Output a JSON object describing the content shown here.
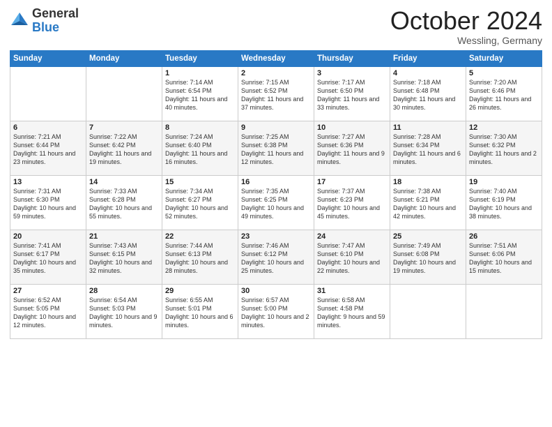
{
  "logo": {
    "general": "General",
    "blue": "Blue"
  },
  "title": "October 2024",
  "location": "Wessling, Germany",
  "days_of_week": [
    "Sunday",
    "Monday",
    "Tuesday",
    "Wednesday",
    "Thursday",
    "Friday",
    "Saturday"
  ],
  "weeks": [
    [
      {
        "day": "",
        "info": ""
      },
      {
        "day": "",
        "info": ""
      },
      {
        "day": "1",
        "info": "Sunrise: 7:14 AM\nSunset: 6:54 PM\nDaylight: 11 hours and 40 minutes."
      },
      {
        "day": "2",
        "info": "Sunrise: 7:15 AM\nSunset: 6:52 PM\nDaylight: 11 hours and 37 minutes."
      },
      {
        "day": "3",
        "info": "Sunrise: 7:17 AM\nSunset: 6:50 PM\nDaylight: 11 hours and 33 minutes."
      },
      {
        "day": "4",
        "info": "Sunrise: 7:18 AM\nSunset: 6:48 PM\nDaylight: 11 hours and 30 minutes."
      },
      {
        "day": "5",
        "info": "Sunrise: 7:20 AM\nSunset: 6:46 PM\nDaylight: 11 hours and 26 minutes."
      }
    ],
    [
      {
        "day": "6",
        "info": "Sunrise: 7:21 AM\nSunset: 6:44 PM\nDaylight: 11 hours and 23 minutes."
      },
      {
        "day": "7",
        "info": "Sunrise: 7:22 AM\nSunset: 6:42 PM\nDaylight: 11 hours and 19 minutes."
      },
      {
        "day": "8",
        "info": "Sunrise: 7:24 AM\nSunset: 6:40 PM\nDaylight: 11 hours and 16 minutes."
      },
      {
        "day": "9",
        "info": "Sunrise: 7:25 AM\nSunset: 6:38 PM\nDaylight: 11 hours and 12 minutes."
      },
      {
        "day": "10",
        "info": "Sunrise: 7:27 AM\nSunset: 6:36 PM\nDaylight: 11 hours and 9 minutes."
      },
      {
        "day": "11",
        "info": "Sunrise: 7:28 AM\nSunset: 6:34 PM\nDaylight: 11 hours and 6 minutes."
      },
      {
        "day": "12",
        "info": "Sunrise: 7:30 AM\nSunset: 6:32 PM\nDaylight: 11 hours and 2 minutes."
      }
    ],
    [
      {
        "day": "13",
        "info": "Sunrise: 7:31 AM\nSunset: 6:30 PM\nDaylight: 10 hours and 59 minutes."
      },
      {
        "day": "14",
        "info": "Sunrise: 7:33 AM\nSunset: 6:28 PM\nDaylight: 10 hours and 55 minutes."
      },
      {
        "day": "15",
        "info": "Sunrise: 7:34 AM\nSunset: 6:27 PM\nDaylight: 10 hours and 52 minutes."
      },
      {
        "day": "16",
        "info": "Sunrise: 7:35 AM\nSunset: 6:25 PM\nDaylight: 10 hours and 49 minutes."
      },
      {
        "day": "17",
        "info": "Sunrise: 7:37 AM\nSunset: 6:23 PM\nDaylight: 10 hours and 45 minutes."
      },
      {
        "day": "18",
        "info": "Sunrise: 7:38 AM\nSunset: 6:21 PM\nDaylight: 10 hours and 42 minutes."
      },
      {
        "day": "19",
        "info": "Sunrise: 7:40 AM\nSunset: 6:19 PM\nDaylight: 10 hours and 38 minutes."
      }
    ],
    [
      {
        "day": "20",
        "info": "Sunrise: 7:41 AM\nSunset: 6:17 PM\nDaylight: 10 hours and 35 minutes."
      },
      {
        "day": "21",
        "info": "Sunrise: 7:43 AM\nSunset: 6:15 PM\nDaylight: 10 hours and 32 minutes."
      },
      {
        "day": "22",
        "info": "Sunrise: 7:44 AM\nSunset: 6:13 PM\nDaylight: 10 hours and 28 minutes."
      },
      {
        "day": "23",
        "info": "Sunrise: 7:46 AM\nSunset: 6:12 PM\nDaylight: 10 hours and 25 minutes."
      },
      {
        "day": "24",
        "info": "Sunrise: 7:47 AM\nSunset: 6:10 PM\nDaylight: 10 hours and 22 minutes."
      },
      {
        "day": "25",
        "info": "Sunrise: 7:49 AM\nSunset: 6:08 PM\nDaylight: 10 hours and 19 minutes."
      },
      {
        "day": "26",
        "info": "Sunrise: 7:51 AM\nSunset: 6:06 PM\nDaylight: 10 hours and 15 minutes."
      }
    ],
    [
      {
        "day": "27",
        "info": "Sunrise: 6:52 AM\nSunset: 5:05 PM\nDaylight: 10 hours and 12 minutes."
      },
      {
        "day": "28",
        "info": "Sunrise: 6:54 AM\nSunset: 5:03 PM\nDaylight: 10 hours and 9 minutes."
      },
      {
        "day": "29",
        "info": "Sunrise: 6:55 AM\nSunset: 5:01 PM\nDaylight: 10 hours and 6 minutes."
      },
      {
        "day": "30",
        "info": "Sunrise: 6:57 AM\nSunset: 5:00 PM\nDaylight: 10 hours and 2 minutes."
      },
      {
        "day": "31",
        "info": "Sunrise: 6:58 AM\nSunset: 4:58 PM\nDaylight: 9 hours and 59 minutes."
      },
      {
        "day": "",
        "info": ""
      },
      {
        "day": "",
        "info": ""
      }
    ]
  ]
}
